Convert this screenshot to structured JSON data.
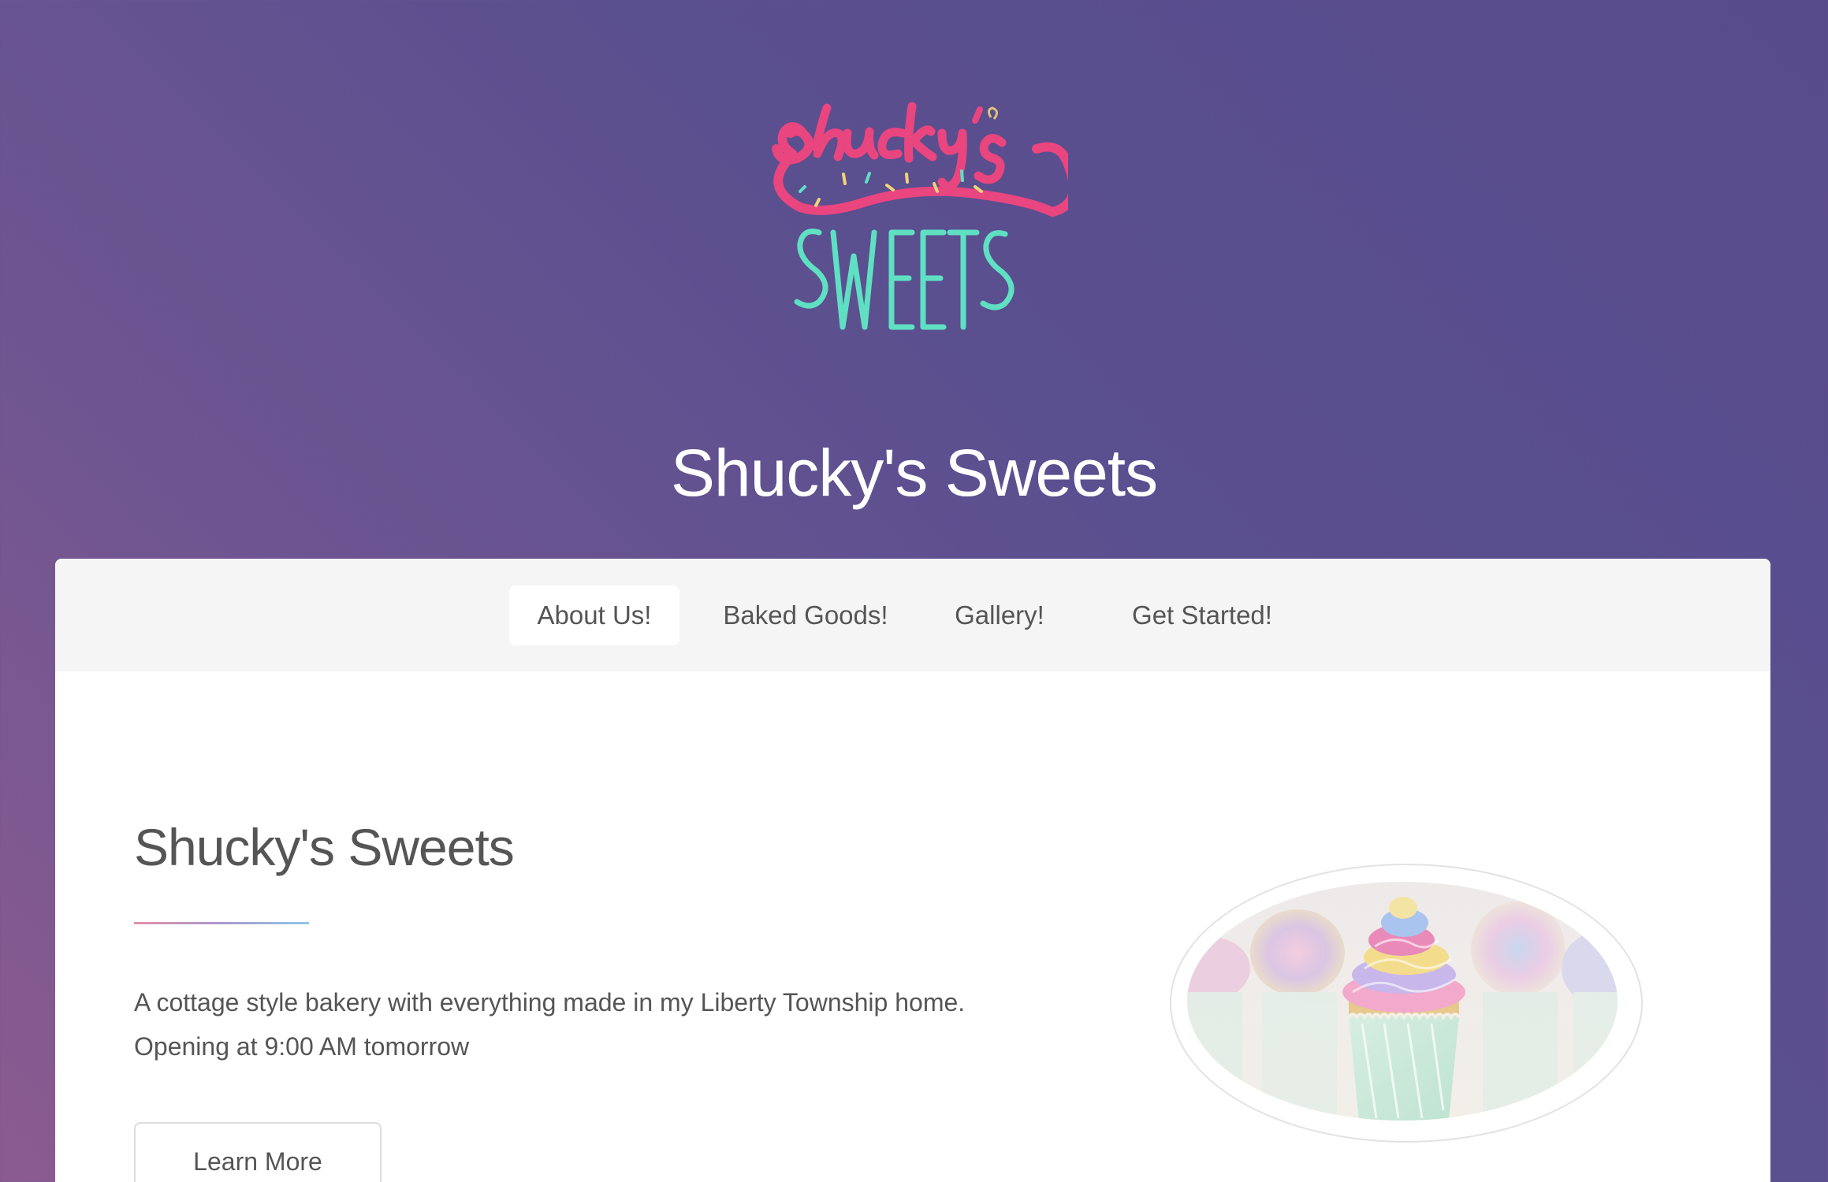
{
  "header": {
    "logo_alt": "Shucky's Sweets",
    "title": "Shucky's Sweets"
  },
  "nav": {
    "items": [
      {
        "label": "About Us!",
        "active": true
      },
      {
        "label": "Baked Goods!",
        "active": false
      },
      {
        "label": "Gallery!",
        "active": false
      },
      {
        "label": "Get Started!",
        "active": false
      }
    ]
  },
  "about": {
    "title": "Shucky's Sweets",
    "description_line1": "A cottage style bakery with everything made in my Liberty Township home.",
    "description_line2": "Opening at 9:00 AM tomorrow",
    "button_label": "Learn More",
    "image_alt": "Pastel rainbow frosted cupcakes"
  },
  "colors": {
    "logo_pink": "#e9457f",
    "logo_teal": "#5fe0c3",
    "background_start": "#8b5b90",
    "background_end": "#574b8c",
    "nav_bg": "#f5f5f5",
    "text": "#555555"
  }
}
